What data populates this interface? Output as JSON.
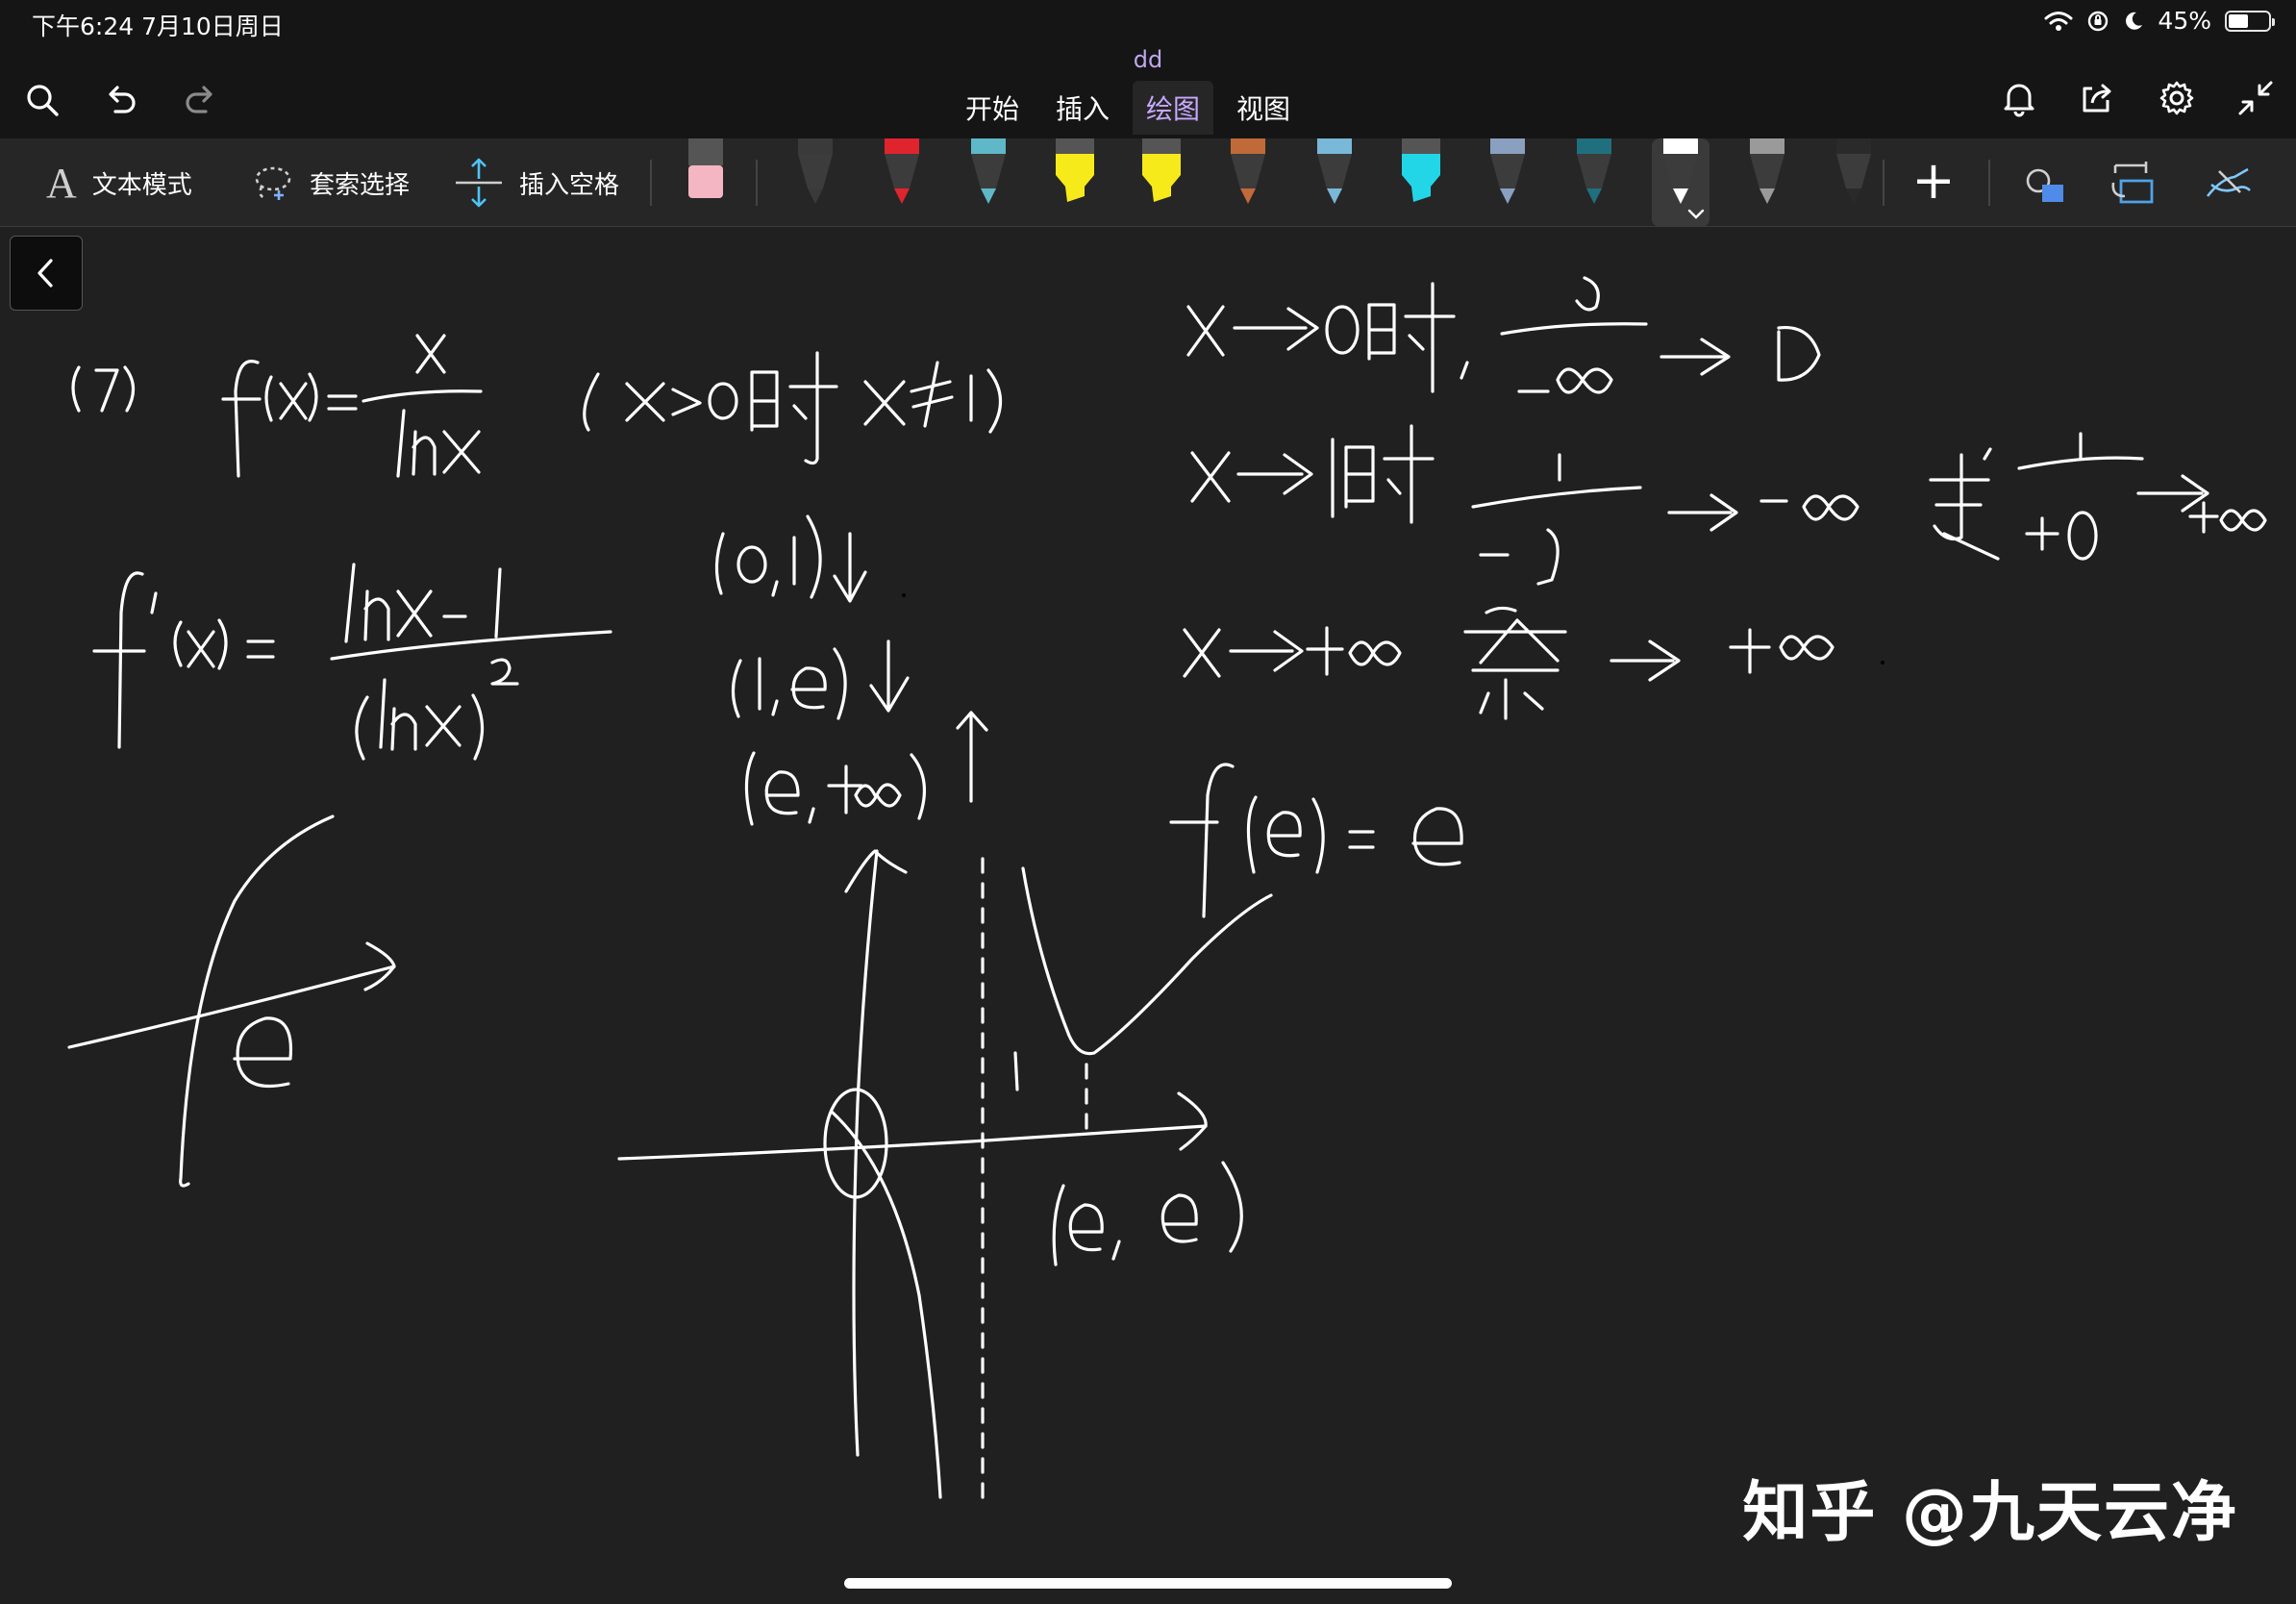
{
  "status_bar": {
    "time": "下午6:24  7月10日周日",
    "battery_text": "45%",
    "battery_level": 0.45,
    "icons": [
      "wifi-icon",
      "orientation-lock-icon",
      "moon-icon",
      "battery-icon"
    ]
  },
  "header": {
    "doc_title": "dd",
    "tabs": [
      {
        "label": "开始",
        "active": false
      },
      {
        "label": "插入",
        "active": false
      },
      {
        "label": "绘图",
        "active": true
      },
      {
        "label": "视图",
        "active": false
      }
    ],
    "left_icons": [
      "search-icon",
      "undo-icon",
      "redo-icon"
    ],
    "right_icons": [
      "bell-icon",
      "share-icon",
      "gear-icon",
      "collapse-icon"
    ]
  },
  "toolbar": {
    "text_mode_label": "文本模式",
    "lasso_label": "套索选择",
    "insert_space_label": "插入空格",
    "eraser_color": "#f4b6c2",
    "pens": [
      {
        "kind": "pen",
        "color": "#3a3a3a"
      },
      {
        "kind": "pen",
        "color": "#e0242e"
      },
      {
        "kind": "pen",
        "color": "#5fb8c8"
      },
      {
        "kind": "highlighter",
        "color": "#f7ea1a"
      },
      {
        "kind": "highlighter",
        "color": "#f7ea1a"
      },
      {
        "kind": "pen",
        "color": "#c06a3a"
      },
      {
        "kind": "pen",
        "color": "#7ab8d8"
      },
      {
        "kind": "highlighter",
        "color": "#22d6e8"
      },
      {
        "kind": "pen",
        "color": "#8aa0c0"
      },
      {
        "kind": "pen",
        "color": "#1f6f7f"
      },
      {
        "kind": "pen",
        "color": "#ffffff",
        "selected": true
      },
      {
        "kind": "pen",
        "color": "#9a9a9a"
      },
      {
        "kind": "pen",
        "color": "#2a2a2a"
      }
    ],
    "add_label": "+"
  },
  "note": {
    "ink_notes": {
      "line1": "(7)  f(x)= x / lnx   (x>0且 x≠1)",
      "line2": "f'(x)= (lnx-1)/(lnx)²",
      "intervals": [
        "(0,1)↓",
        "(1,e)↓",
        "(e,+∞)↑"
      ],
      "limit1": "x→0时, 0/-∞ → 0",
      "limit2": "x→1时 1/-0 → -∞ 或 1/+0 → +∞",
      "limit3": "x→+∞ 洛 → +∞.",
      "fe": "f(e) = e",
      "point": "(e,e)",
      "sketch_label": "e"
    }
  },
  "watermark": "知乎 @九天云净"
}
